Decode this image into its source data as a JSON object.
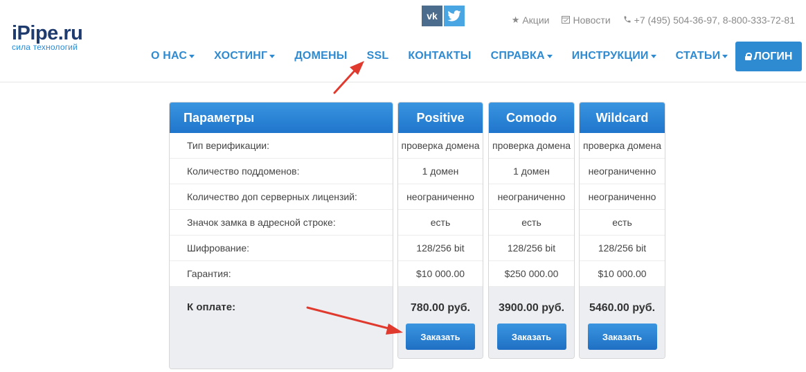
{
  "logo": {
    "main": "iPipe.ru",
    "sub": "сила технологий"
  },
  "social": {
    "vk": "vk-icon",
    "twitter": "twitter-icon"
  },
  "toplinks": {
    "actions": "Акции",
    "news": "Новости",
    "phone": "+7 (495) 504-36-97, 8-800-333-72-81"
  },
  "nav": [
    {
      "label": "О НАС",
      "dropdown": true
    },
    {
      "label": "ХОСТИНГ",
      "dropdown": true
    },
    {
      "label": "ДОМЕНЫ",
      "dropdown": false
    },
    {
      "label": "SSL",
      "dropdown": false
    },
    {
      "label": "КОНТАКТЫ",
      "dropdown": false
    },
    {
      "label": "СПРАВКА",
      "dropdown": true
    },
    {
      "label": "ИНСТРУКЦИИ",
      "dropdown": true
    },
    {
      "label": "СТАТЬИ",
      "dropdown": true
    }
  ],
  "login_label": "ЛОГИН",
  "params": {
    "title": "Параметры",
    "rows": [
      "Тип верификации:",
      "Количество поддоменов:",
      "Количество доп серверных лицензий:",
      "Значок замка в адресной строке:",
      "Шифрование:",
      "Гарантия:"
    ],
    "pay_label": "К оплате:"
  },
  "plans": [
    {
      "name": "Positive",
      "values": [
        "проверка домена",
        "1 домен",
        "неограниченно",
        "есть",
        "128/256 bit",
        "$10 000.00"
      ],
      "price": "780.00 руб.",
      "button": "Заказать"
    },
    {
      "name": "Comodo",
      "values": [
        "проверка домена",
        "1 домен",
        "неограниченно",
        "есть",
        "128/256 bit",
        "$250 000.00"
      ],
      "price": "3900.00 руб.",
      "button": "Заказать"
    },
    {
      "name": "Wildcard",
      "values": [
        "проверка домена",
        "неограниченно",
        "неограниченно",
        "есть",
        "128/256 bit",
        "$10 000.00"
      ],
      "price": "5460.00 руб.",
      "button": "Заказать"
    }
  ],
  "colors": {
    "accent": "#2e8ad1",
    "header_gradient_top": "#3a95e0",
    "header_gradient_bottom": "#1f75cc",
    "annotation_arrow": "#e03a2f"
  }
}
